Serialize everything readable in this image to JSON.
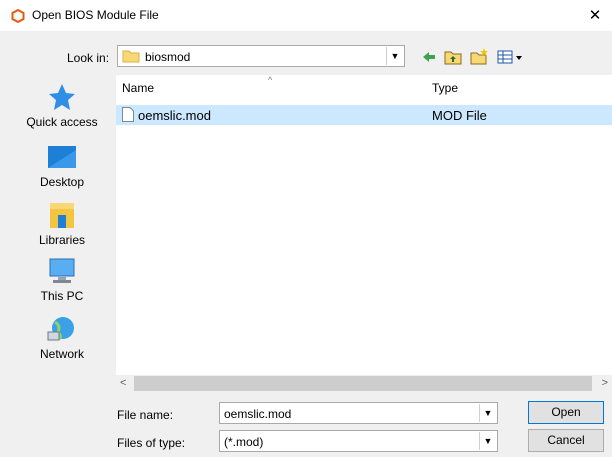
{
  "window": {
    "title": "Open BIOS Module File",
    "close_glyph": "✕"
  },
  "look_in": {
    "label": "Look in:",
    "value": "biosmod"
  },
  "toolbar": {
    "icons": [
      "back-icon",
      "up-folder-icon",
      "new-folder-icon",
      "view-menu-icon"
    ]
  },
  "places": [
    {
      "label": "Quick access",
      "icon": "star-icon"
    },
    {
      "label": "Desktop",
      "icon": "desktop-icon"
    },
    {
      "label": "Libraries",
      "icon": "libraries-icon"
    },
    {
      "label": "This PC",
      "icon": "computer-icon"
    },
    {
      "label": "Network",
      "icon": "network-icon"
    }
  ],
  "file_list": {
    "columns": [
      "Name",
      "Type"
    ],
    "sort_glyph": "^",
    "rows": [
      {
        "name": "oemslic.mod",
        "type": "MOD File",
        "selected": true
      }
    ]
  },
  "scroll": {
    "left_glyph": "<",
    "right_glyph": ">"
  },
  "file_name": {
    "label": "File name:",
    "value": "oemslic.mod"
  },
  "file_type": {
    "label": "Files of type:",
    "value": "(*.mod)"
  },
  "buttons": {
    "open": "Open",
    "cancel": "Cancel"
  },
  "colors": {
    "selection": "#cce8ff",
    "accent": "#0078d7",
    "title_icon": "#e8590c"
  }
}
